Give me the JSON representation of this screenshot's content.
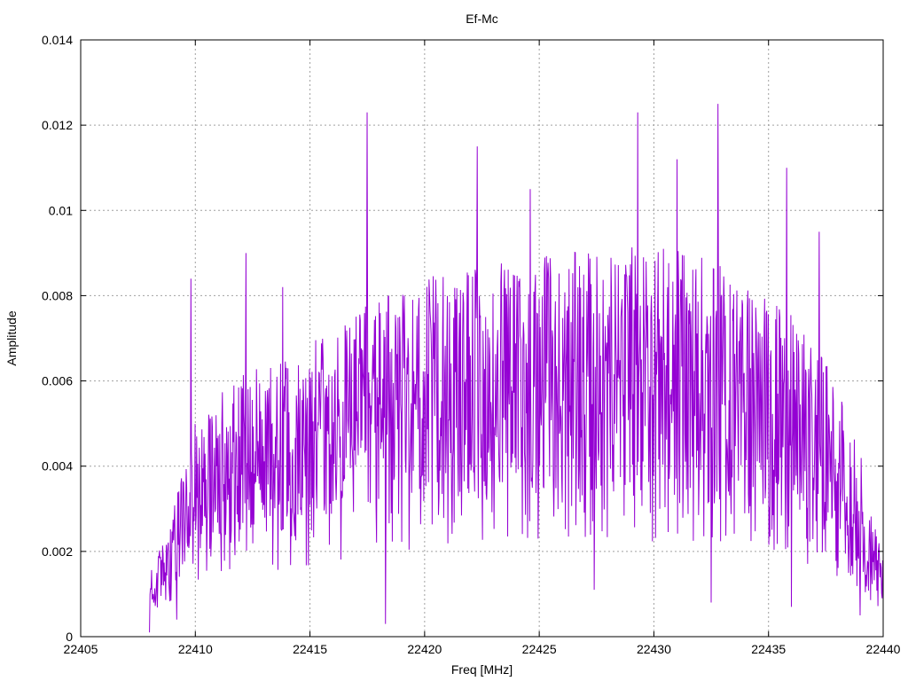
{
  "chart_data": {
    "type": "line",
    "title": "Ef-Mc",
    "xlabel": "Freq [MHz]",
    "ylabel": "Amplitude",
    "xlim": [
      22405,
      22440
    ],
    "ylim": [
      0,
      0.014
    ],
    "xticks": [
      "22405",
      "22410",
      "22415",
      "22420",
      "22425",
      "22430",
      "22435",
      "22440"
    ],
    "yticks": [
      "0",
      "0.002",
      "0.004",
      "0.006",
      "0.008",
      "0.01",
      "0.012",
      "0.014"
    ],
    "grid": true,
    "legend": "none",
    "series": [
      {
        "color": "#9400d3",
        "x_start": 22408.0,
        "x_end": 22440.0,
        "envelope": {
          "x": [
            22408.0,
            22409.0,
            22410.0,
            22411.0,
            22412.0,
            22414.0,
            22416.0,
            22418.0,
            22420.0,
            22422.0,
            22424.0,
            22426.0,
            22428.0,
            22430.0,
            22432.0,
            22434.0,
            22436.0,
            22437.5,
            22439.0,
            22440.0
          ],
          "y": [
            0.001,
            0.002,
            0.0035,
            0.004,
            0.0043,
            0.0045,
            0.005,
            0.0055,
            0.0058,
            0.006,
            0.0061,
            0.0062,
            0.0063,
            0.0063,
            0.0062,
            0.0058,
            0.0052,
            0.0045,
            0.003,
            0.0012
          ]
        },
        "peaks": [
          {
            "x": 22409.8,
            "y": 0.0084
          },
          {
            "x": 22412.2,
            "y": 0.009
          },
          {
            "x": 22413.8,
            "y": 0.0082
          },
          {
            "x": 22417.5,
            "y": 0.0123
          },
          {
            "x": 22422.3,
            "y": 0.0115
          },
          {
            "x": 22424.6,
            "y": 0.0105
          },
          {
            "x": 22429.3,
            "y": 0.0123
          },
          {
            "x": 22431.0,
            "y": 0.0112
          },
          {
            "x": 22432.8,
            "y": 0.0125
          },
          {
            "x": 22435.8,
            "y": 0.011
          },
          {
            "x": 22437.2,
            "y": 0.0095
          }
        ],
        "dips": [
          {
            "x": 22408.0,
            "y": 0.0001
          },
          {
            "x": 22409.2,
            "y": 0.0004
          },
          {
            "x": 22418.3,
            "y": 0.0003
          },
          {
            "x": 22427.4,
            "y": 0.0011
          },
          {
            "x": 22432.5,
            "y": 0.0008
          },
          {
            "x": 22436.0,
            "y": 0.0007
          },
          {
            "x": 22439.0,
            "y": 0.0005
          }
        ]
      }
    ]
  }
}
